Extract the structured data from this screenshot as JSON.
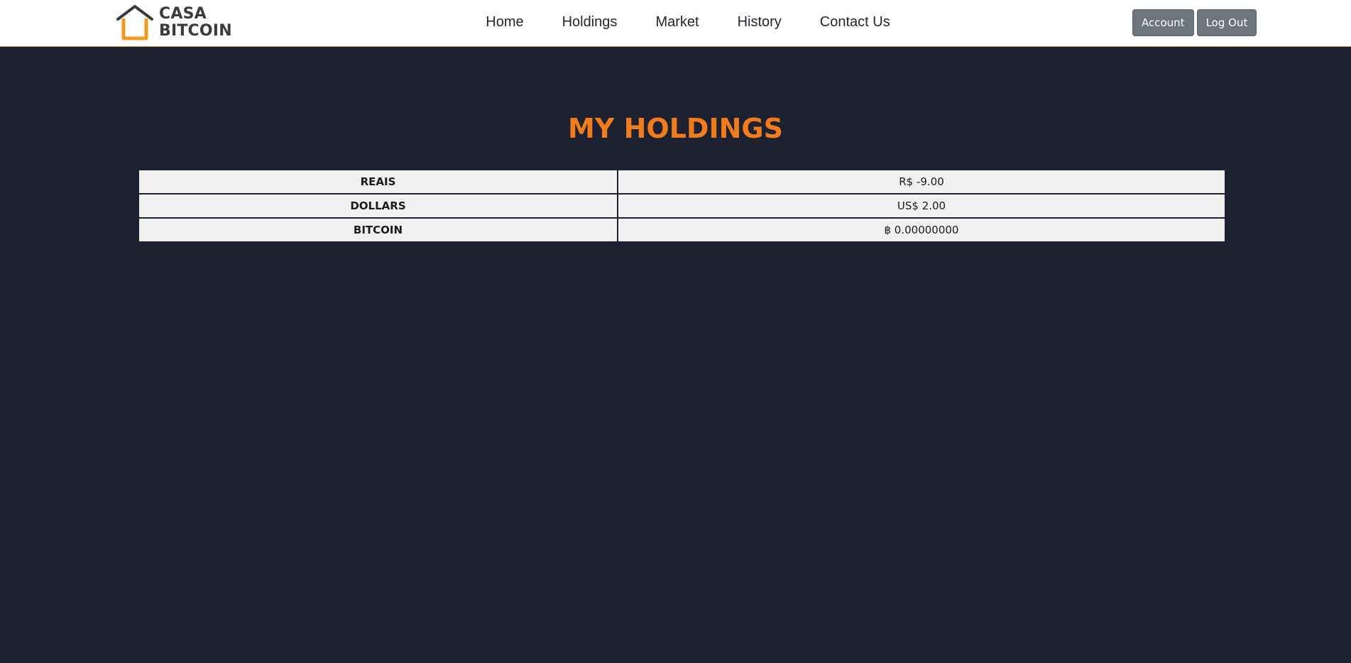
{
  "brand": {
    "name_line1": "CASA",
    "name_line2": "BITCOIN",
    "primary_color": "#f39a1c",
    "text_color": "#3b3b3b",
    "icon": "house-icon"
  },
  "nav": {
    "links": [
      "Home",
      "Holdings",
      "Market",
      "History",
      "Contact Us"
    ],
    "account_label": "Account",
    "logout_label": "Log Out"
  },
  "page": {
    "title": "MY HOLDINGS",
    "background_color": "#1e2230",
    "title_color": "#f07c1e"
  },
  "holdings": {
    "rows": [
      {
        "label": "REAIS",
        "value": "R$ -9.00"
      },
      {
        "label": "DOLLARS",
        "value": "US$ 2.00"
      },
      {
        "label": "BITCOIN",
        "value": "฿ 0.00000000"
      }
    ]
  }
}
